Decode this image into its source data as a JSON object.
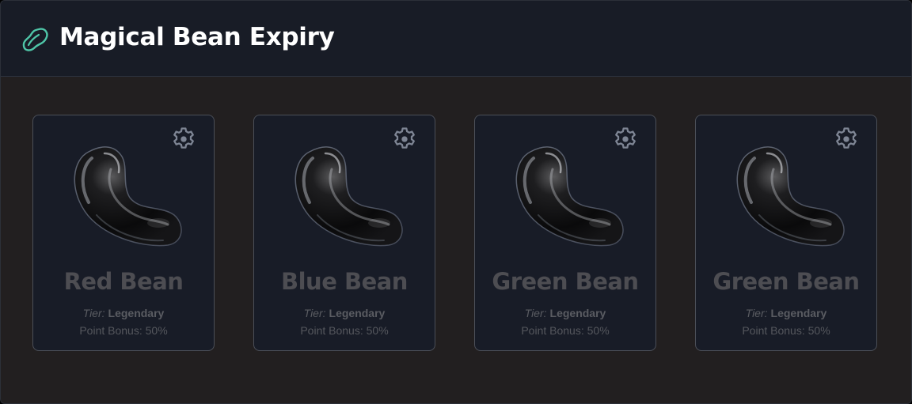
{
  "app": {
    "title": "Magical Bean Expiry",
    "logo_icon": "bean-outline-icon",
    "accent_color": "#4fc6a8"
  },
  "cards": [
    {
      "name": "Red Bean",
      "tier_label": "Tier:",
      "tier_value": "Legendary",
      "bonus": "Point Bonus: 50%",
      "image": "black-bean-image",
      "settings_icon": "gear-icon"
    },
    {
      "name": "Blue Bean",
      "tier_label": "Tier:",
      "tier_value": "Legendary",
      "bonus": "Point Bonus: 50%",
      "image": "black-bean-image",
      "settings_icon": "gear-icon"
    },
    {
      "name": "Green Bean",
      "tier_label": "Tier:",
      "tier_value": "Legendary",
      "bonus": "Point Bonus: 50%",
      "image": "black-bean-image",
      "settings_icon": "gear-icon"
    },
    {
      "name": "Green Bean",
      "tier_label": "Tier:",
      "tier_value": "Legendary",
      "bonus": "Point Bonus: 50%",
      "image": "black-bean-image",
      "settings_icon": "gear-icon"
    }
  ]
}
